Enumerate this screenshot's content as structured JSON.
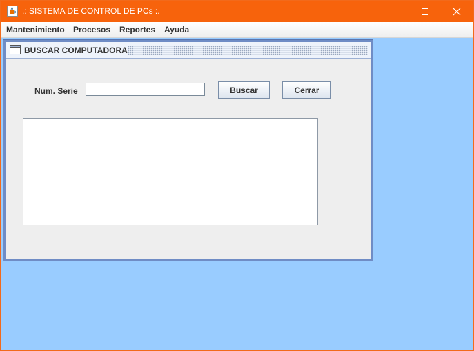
{
  "window": {
    "title": ".: SISTEMA DE CONTROL DE PCs :.",
    "icon": "java-cup-icon",
    "controls": [
      "minimize-icon",
      "maximize-icon",
      "close-icon"
    ],
    "title_bar_color": "#f7630c"
  },
  "menubar": {
    "items": [
      "Mantenimiento",
      "Procesos",
      "Reportes",
      "Ayuda"
    ]
  },
  "desktop": {
    "background": "#99ccff"
  },
  "internal_frame": {
    "title": "BUSCAR COMPUTADORA",
    "icon": "window-icon",
    "form": {
      "serial_label": "Num. Serie",
      "serial_value": "",
      "search_button": "Buscar",
      "close_button": "Cerrar"
    },
    "results": ""
  }
}
